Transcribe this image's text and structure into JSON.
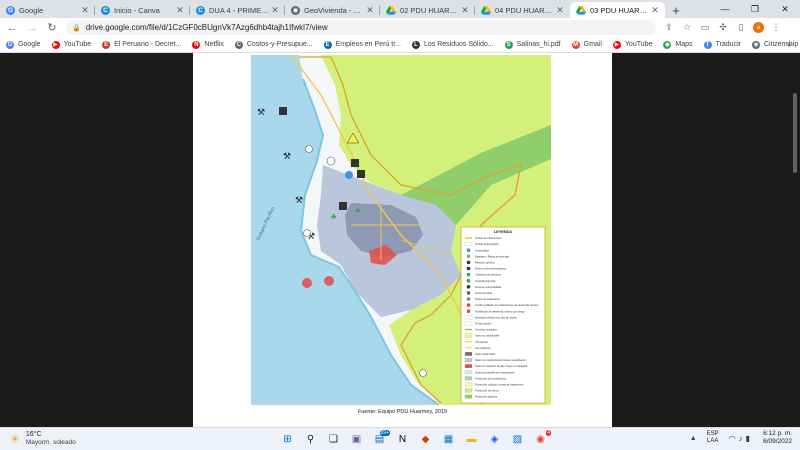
{
  "browser": {
    "tabs": [
      {
        "title": "Google",
        "favicon": "google-favicon",
        "color": "#4285f4",
        "glyph": "G"
      },
      {
        "title": "Inicio - Canva",
        "favicon": "canva-favicon",
        "color": "#1a8cd8",
        "glyph": "C"
      },
      {
        "title": "DUA 4 - PRIMERA UNIDAD",
        "favicon": "canva-favicon",
        "color": "#1a8cd8",
        "glyph": "C"
      },
      {
        "title": "GeoVivienda - Ministerio",
        "favicon": "globe-favicon",
        "color": "#5f6368",
        "glyph": "◉"
      },
      {
        "title": "02 PDU HUARMEY_T1.pdf",
        "favicon": "drive-favicon",
        "color": "#1fa463",
        "glyph": ""
      },
      {
        "title": "04 PDU HUARMEY_SIS...",
        "favicon": "drive-favicon",
        "color": "#1fa463",
        "glyph": ""
      },
      {
        "title": "03 PDU HUARMEY_T2.pdf",
        "favicon": "drive-favicon",
        "color": "#1fa463",
        "glyph": ""
      }
    ],
    "active_tab": 6,
    "url": "drive.google.com/file/d/1CzGF0cBUgnVk7Azg6dhb4tajh1Ifwkl7/view"
  },
  "bookmarks": [
    {
      "label": "Google",
      "color": "#4285f4",
      "glyph": "G"
    },
    {
      "label": "YouTube",
      "color": "#ff0000",
      "glyph": "▶"
    },
    {
      "label": "El Peruano - Decret...",
      "color": "#c0392b",
      "glyph": "E"
    },
    {
      "label": "Netflix",
      "color": "#e50914",
      "glyph": "N"
    },
    {
      "label": "Costos-y-Presupue...",
      "color": "#5f6368",
      "glyph": "C"
    },
    {
      "label": "Empleos en Perú tr...",
      "color": "#0a66c2",
      "glyph": "E"
    },
    {
      "label": "Los Residuos Sólido...",
      "color": "#333333",
      "glyph": "L"
    },
    {
      "label": "Salinas_hi.pdf",
      "color": "#1fa463",
      "glyph": "S"
    },
    {
      "label": "Gmail",
      "color": "#ea4335",
      "glyph": "M"
    },
    {
      "label": "YouTube",
      "color": "#ff0000",
      "glyph": "▶"
    },
    {
      "label": "Maps",
      "color": "#34a853",
      "glyph": "◆"
    },
    {
      "label": "Traducir",
      "color": "#4285f4",
      "glyph": "T"
    },
    {
      "label": "Citizenship Integrat...",
      "color": "#5f6368",
      "glyph": "◉"
    }
  ],
  "document": {
    "caption": "Fuente: Equipo PDU Huarmey, 2019",
    "map": {
      "legend_title": "LEYENDA",
      "legend_items": [
        {
          "label": "Ámbito de intervención",
          "color": "#f2a81d",
          "kind": "line"
        },
        {
          "label": "Ámbito arqueológico",
          "color": "#ffffff",
          "kind": "box"
        },
        {
          "label": "Universidad",
          "color": "#4a90e2",
          "kind": "dot"
        },
        {
          "label": "Botadero / Planta de reciclaje",
          "color": "#6dbf4b",
          "kind": "dot"
        },
        {
          "label": "Recurso turístico",
          "color": "#333333",
          "kind": "dot"
        },
        {
          "label": "Puerto y terminal pesquero",
          "color": "#333333",
          "kind": "dot"
        },
        {
          "label": "Cobertura de servicios",
          "color": "#3aa655",
          "kind": "dot"
        },
        {
          "label": "Actividad agrícola",
          "color": "#3aa655",
          "kind": "dot"
        },
        {
          "label": "Zona de vulnerabilidad",
          "color": "#333333",
          "kind": "dot"
        },
        {
          "label": "Zona industrial",
          "color": "#5f6368",
          "kind": "dot"
        },
        {
          "label": "Planta de tratamiento",
          "color": "#888888",
          "kind": "dot"
        },
        {
          "label": "Cordón poblado con restricciones de desarrollo urbano",
          "color": "#e34b4b",
          "kind": "dot"
        },
        {
          "label": "Prohibición de desarrollo urbano por riesgo",
          "color": "#e34b4b",
          "kind": "dot"
        },
        {
          "label": "Actividad turística con uso de Saneo",
          "color": "#ffffff",
          "kind": "box"
        },
        {
          "label": "Frente costero",
          "color": "#ffffff",
          "kind": "box"
        },
        {
          "label": "Corredor ecológico",
          "color": "#7bbf3f",
          "kind": "line"
        },
        {
          "label": "Suelo no urbanizable",
          "color": "#f3f77a",
          "kind": "box"
        },
        {
          "label": "Vía arterial",
          "color": "#f2e600",
          "kind": "line"
        },
        {
          "label": "Vía colectora",
          "color": "#f7d26b",
          "kind": "line"
        },
        {
          "label": "Suelo urbanizado",
          "color": "#6e6e6e",
          "kind": "box"
        },
        {
          "label": "Suelo con restricciones físicas consolidación",
          "color": "#c8c8c8",
          "kind": "box"
        },
        {
          "label": "Suelo en situación de alto riesgo no mitigable",
          "color": "#e34b4b",
          "kind": "box"
        },
        {
          "label": "Suelo susceptible de urbanización",
          "color": "#dfe6f3",
          "kind": "box"
        },
        {
          "label": "Protección de ecosistemas",
          "color": "#a8d8a0",
          "kind": "box"
        },
        {
          "label": "Protección cultural y zonas de tratamiento",
          "color": "#fff5a0",
          "kind": "box"
        },
        {
          "label": "Protección de cerros",
          "color": "#c8e88a",
          "kind": "box"
        },
        {
          "label": "Protección agrícola",
          "color": "#8fce6a",
          "kind": "box"
        }
      ],
      "place_labels": [
        "Océano Pacífico"
      ],
      "colors": {
        "ocean": "#a9d8ec",
        "shoreline": "#7cc6e0",
        "hills": "#d2f07a",
        "urban_expansion": "#b9c6dc",
        "urban": "#8e9ab4",
        "roads": "#f2c94c",
        "boundary": "#e0a030",
        "risk": "#e34b4b"
      }
    }
  },
  "taskbar": {
    "weather_temp": "16°C",
    "weather_desc": "Mayorm. soleado",
    "lang_top": "ESP",
    "lang_bottom": "LAA",
    "time": "6:12 p. m.",
    "date": "6/09/2022",
    "widgets_badge": "99+",
    "chrome_badge": "4"
  }
}
